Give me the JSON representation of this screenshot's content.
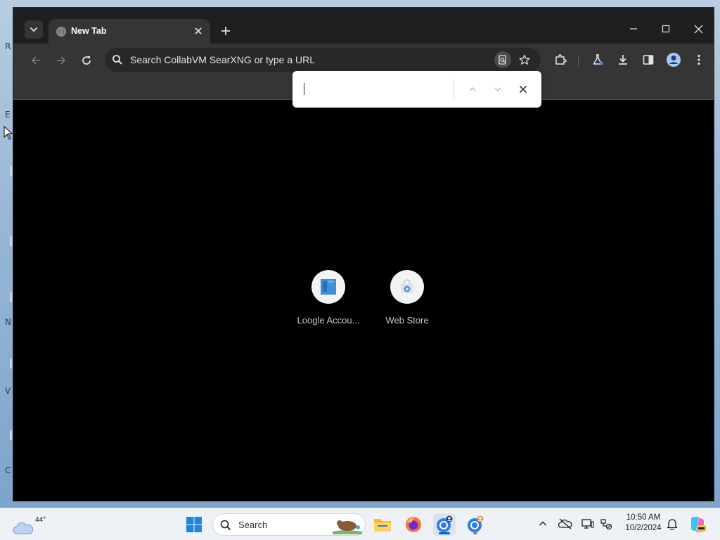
{
  "browser": {
    "tab": {
      "title": "New Tab"
    },
    "omnibox": {
      "placeholder": "Search CollabVM SearXNG or type a URL"
    },
    "find_bar": {
      "value": ""
    },
    "shortcuts": [
      {
        "label": "Loogle Accou..."
      },
      {
        "label": "Web Store"
      }
    ],
    "theme": {
      "tabstrip": "#1f1f1f",
      "toolbar": "#353535",
      "content": "#000000"
    }
  },
  "taskbar": {
    "weather_temp": "44°",
    "search_placeholder": "Search",
    "clock": {
      "time": "10:50 AM",
      "date": "10/2/2024"
    },
    "pinned": [
      "start-icon",
      "file-explorer-icon",
      "firefox-icon",
      "chrome-icon",
      "chrome-profile-icon"
    ],
    "accent": "#0067c0"
  },
  "desktop": {
    "edge_letters": [
      "R",
      "E",
      "N",
      "V",
      "C"
    ]
  }
}
